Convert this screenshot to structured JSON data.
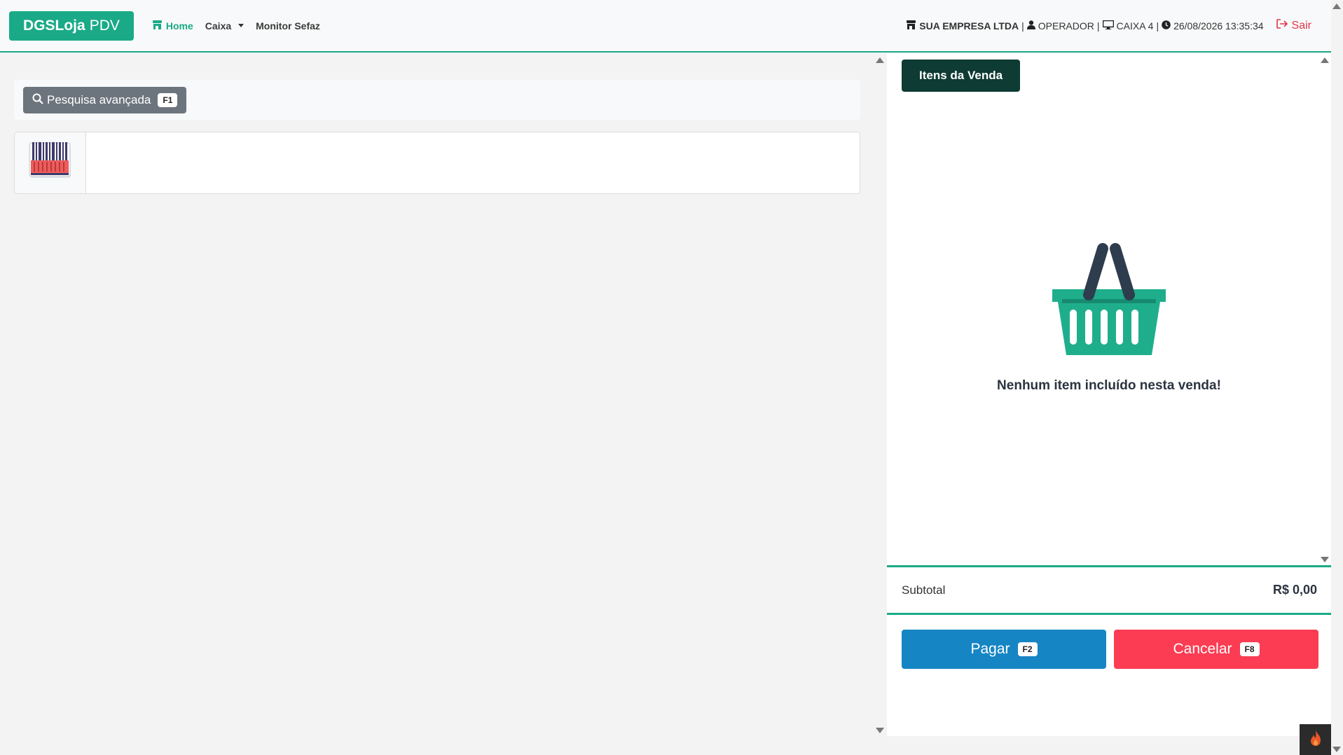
{
  "brand": {
    "bold": "DGSLoja",
    "rest": "PDV"
  },
  "nav": {
    "home": "Home",
    "caixa": "Caixa",
    "monitor": "Monitor Sefaz"
  },
  "status": {
    "company": "SUA EMPRESA LTDA",
    "operator": "OPERADOR",
    "register": "CAIXA 4",
    "datetime": "26/08/2026 13:35:34",
    "separator": "|",
    "logout": "Sair"
  },
  "search": {
    "advanced_label": "Pesquisa avançada",
    "advanced_key": "F1"
  },
  "cart": {
    "tab_label": "Itens da Venda",
    "empty_message": "Nenhum item incluído nesta venda!",
    "subtotal_label": "Subtotal",
    "subtotal_value": "R$ 0,00",
    "pay_label": "Pagar",
    "pay_key": "F2",
    "cancel_label": "Cancelar",
    "cancel_key": "F8"
  },
  "colors": {
    "accent": "#1aaa87",
    "dark_tab": "#0e3b33",
    "pay": "#1585c4",
    "cancel": "#fb3c53",
    "logout": "#e0364a"
  },
  "icons": [
    "store-icon",
    "user-icon",
    "monitor-icon",
    "clock-icon",
    "logout-icon",
    "search-icon",
    "barcode-icon",
    "basket-icon",
    "flame-icon"
  ]
}
